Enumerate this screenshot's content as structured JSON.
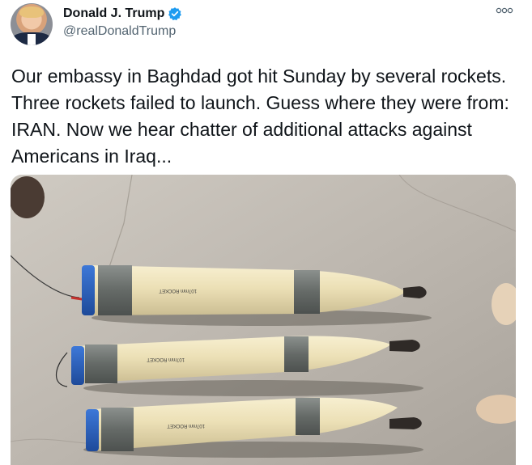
{
  "user": {
    "display_name": "Donald J. Trump",
    "handle": "@realDonaldTrump",
    "verified": true
  },
  "tweet": {
    "text": "Our embassy in Baghdad got hit Sunday by several rockets. Three rockets failed to launch. Guess where they were from: IRAN. Now we hear chatter of additional attacks against Americans in Iraq..."
  },
  "icons": {
    "avatar": "profile-photo",
    "verified": "verified-badge-icon",
    "more": "more-options-icon"
  },
  "colors": {
    "verified": "#1d9bf0",
    "rocket_body": "#efe4bd",
    "rocket_band": "#6f7471",
    "rocket_cap": "#2b62c4"
  }
}
